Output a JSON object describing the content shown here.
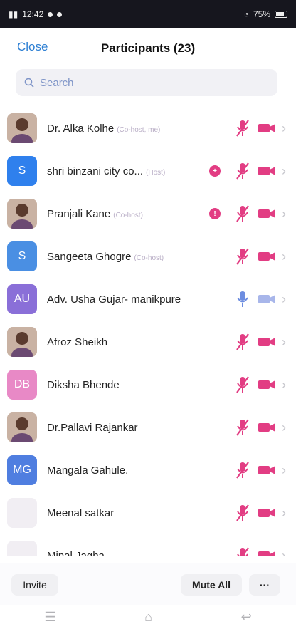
{
  "status": {
    "time": "12:42",
    "battery": "75%"
  },
  "header": {
    "close_label": "Close",
    "title": "Participants (23)"
  },
  "search": {
    "placeholder": "Search"
  },
  "participants": [
    {
      "name": "Dr. Alka Kolhe",
      "role": "(Co-host, me)",
      "avatar_type": "photo",
      "initials": ""
    },
    {
      "name": "shri binzani city co...",
      "role": "(Host)",
      "avatar_type": "initials",
      "initials": "S",
      "avatar_color": "#2f80ed",
      "raise_icon": "plus-icon"
    },
    {
      "name": "Pranjali Kane",
      "role": "(Co-host)",
      "avatar_type": "photo",
      "initials": "",
      "raise_icon": "hand-icon"
    },
    {
      "name": "Sangeeta Ghogre",
      "role": "(Co-host)",
      "avatar_type": "initials",
      "initials": "S",
      "avatar_color": "#4a8fe3"
    },
    {
      "name": "Adv. Usha Gujar- manikpure",
      "role": "",
      "avatar_type": "initials",
      "initials": "AU",
      "avatar_color": "#8a6fd8",
      "mic_on": true
    },
    {
      "name": "Afroz Sheikh",
      "role": "",
      "avatar_type": "photo",
      "initials": ""
    },
    {
      "name": "Diksha Bhende",
      "role": "",
      "avatar_type": "initials",
      "initials": "DB",
      "avatar_color": "#e889c6"
    },
    {
      "name": "Dr.Pallavi Rajankar",
      "role": "",
      "avatar_type": "photo",
      "initials": ""
    },
    {
      "name": "Mangala Gahule.",
      "role": "",
      "avatar_type": "initials",
      "initials": "MG",
      "avatar_color": "#4f7ee0"
    },
    {
      "name": "Meenal satkar",
      "role": "",
      "avatar_type": "initials",
      "initials": "",
      "avatar_color": "#f1eef3"
    },
    {
      "name": "Minal Jagha",
      "role": "",
      "avatar_type": "initials",
      "initials": "",
      "avatar_color": "#f1eef3"
    }
  ],
  "bottom_bar": {
    "invite_label": "Invite",
    "mute_all_label": "Mute All",
    "more_label": "···"
  },
  "colors": {
    "accent": "#2d7fd3",
    "muted_icon": "#e23d83",
    "mic_on": "#6d8de0"
  }
}
